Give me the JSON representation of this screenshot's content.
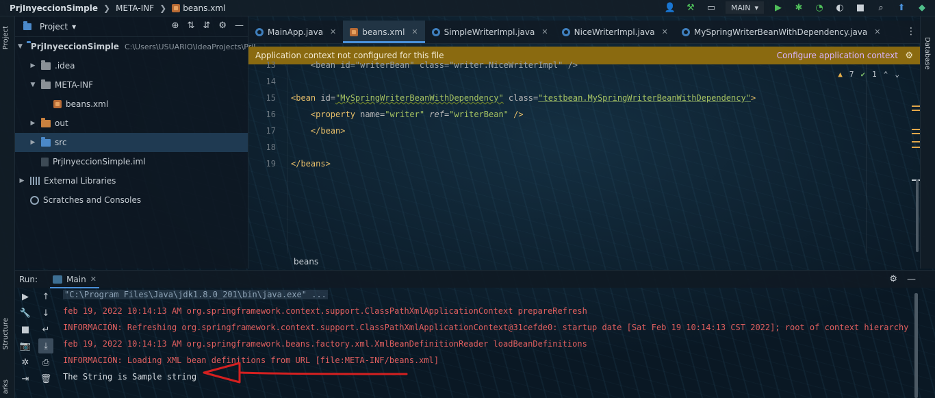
{
  "navbar": {
    "breadcrumbs": [
      "PrjInyeccionSimple",
      "META-INF",
      "beans.xml"
    ],
    "run_config": "MAIN"
  },
  "left_strip": {
    "project_tab": "Project",
    "structure_tab": "Structure",
    "bookmarks_tab": "arks"
  },
  "right_strip": {
    "database_tab": "Database"
  },
  "project_panel": {
    "title": "Project",
    "tree": [
      {
        "label": "PrjInyeccionSimple",
        "hint": "C:\\Users\\USUARIO\\IdeaProjects\\PrjI"
      },
      {
        "label": ".idea"
      },
      {
        "label": "META-INF"
      },
      {
        "label": "beans.xml"
      },
      {
        "label": "out"
      },
      {
        "label": "src"
      },
      {
        "label": "PrjInyeccionSimple.iml"
      },
      {
        "label": "External Libraries"
      },
      {
        "label": "Scratches and Consoles"
      }
    ]
  },
  "tabs": [
    {
      "label": "MainApp.java",
      "icon": "java-class-icon"
    },
    {
      "label": "beans.xml",
      "icon": "xml-file-icon",
      "active": true
    },
    {
      "label": "SimpleWriterImpl.java",
      "icon": "java-class-icon"
    },
    {
      "label": "NiceWriterImpl.java",
      "icon": "java-class-icon"
    },
    {
      "label": "MySpringWriterBeanWithDependency.java",
      "icon": "java-class-icon"
    }
  ],
  "notice": {
    "text": "Application context not configured for this file",
    "action": "Configure application context"
  },
  "editor": {
    "inspections": {
      "warnings": "7",
      "ok": "1"
    },
    "lines": [
      {
        "num": "13",
        "text": "    <bean id=\"writerBean\" class=\"writer.NiceWriterImpl\" />"
      },
      {
        "num": "14",
        "text": ""
      },
      {
        "num": "15",
        "tag_open": "<bean ",
        "a1": "id=",
        "v1": "\"MySpringWriterBeanWithDependency\"",
        "a2": " class=",
        "v2": "\"testbean.MySpringWriterBeanWithDependency\"",
        "tag_close": ">"
      },
      {
        "num": "16",
        "tag_open": "    <property ",
        "a1": "name=",
        "v1": "\"writer\"",
        "a2": " ref=",
        "v2": "\"writerBean\"",
        "tag_close": " />"
      },
      {
        "num": "17",
        "text": "    </bean>"
      },
      {
        "num": "18",
        "text": ""
      },
      {
        "num": "19",
        "text": "</beans>"
      }
    ]
  },
  "breadcrumb_bar": "beans",
  "run_panel": {
    "label": "Run:",
    "tab": "Main",
    "console": [
      {
        "type": "cmd",
        "text": "\"C:\\Program Files\\Java\\jdk1.8.0_201\\bin\\java.exe\" ..."
      },
      {
        "type": "err",
        "text": "feb 19, 2022 10:14:13 AM org.springframework.context.support.ClassPathXmlApplicationContext prepareRefresh"
      },
      {
        "type": "err",
        "text": "INFORMACIÓN: Refreshing org.springframework.context.support.ClassPathXmlApplicationContext@31cefde0: startup date [Sat Feb 19 10:14:13 CST 2022]; root of context hierarchy"
      },
      {
        "type": "err",
        "text": "feb 19, 2022 10:14:13 AM org.springframework.beans.factory.xml.XmlBeanDefinitionReader loadBeanDefinitions"
      },
      {
        "type": "err",
        "text": "INFORMACIÓN: Loading XML bean definitions from URL [file:META-INF/beans.xml]"
      },
      {
        "type": "out",
        "text": "The String is Sample string"
      }
    ]
  },
  "colors": {
    "accent": "#4a90d9",
    "notice_bg": "#8a6a10",
    "console_error": "#e05f5f",
    "annotation_arrow": "#d42020"
  }
}
